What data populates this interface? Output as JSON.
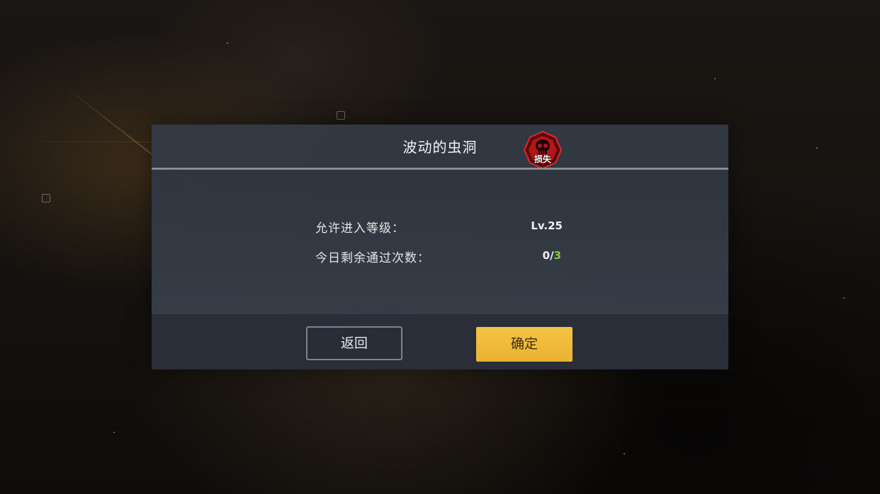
{
  "dialog": {
    "title": "波动的虫洞",
    "badge": {
      "icon": "skull-icon",
      "label": "损失",
      "color": "#c0161b"
    },
    "rows": [
      {
        "label": "允许进入等级：",
        "value": "Lv.25"
      },
      {
        "label": "今日剩余通过次数：",
        "value_current": "0",
        "value_separator": "/",
        "value_max": "3"
      }
    ],
    "buttons": {
      "back_label": "返回",
      "confirm_label": "确定"
    }
  },
  "colors": {
    "confirm_button": "#f0bb3a",
    "remaining_max": "#8cc63f"
  }
}
